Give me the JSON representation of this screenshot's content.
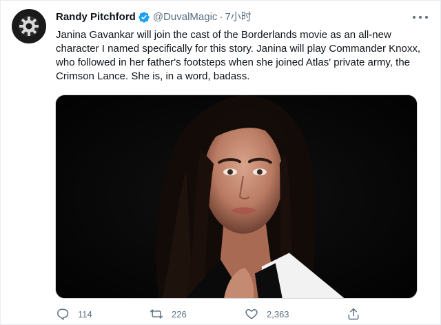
{
  "tweet": {
    "author": {
      "display_name": "Randy Pitchford",
      "handle": "@DuvalMagic",
      "verified": true,
      "avatar_icon": "gear-logo-icon"
    },
    "separator": "·",
    "time": "7小时",
    "text": "Janina Gavankar will join the cast of the Borderlands movie as an all-new character I named specifically for this story. Janina will play Commander Knoxx, who followed in her father's footsteps when she joined Atlas' private army, the Crimson Lance. She is, in a word, badass.",
    "media": {
      "kind": "photo"
    },
    "actions": {
      "reply": {
        "icon": "reply-icon",
        "count": "114"
      },
      "retweet": {
        "icon": "retweet-icon",
        "count": "226"
      },
      "like": {
        "icon": "heart-icon",
        "count": "2,363"
      },
      "share": {
        "icon": "share-icon",
        "count": ""
      }
    }
  },
  "colors": {
    "text_primary": "#0f1419",
    "text_secondary": "#5b7083",
    "verified_blue": "#1da1f2",
    "border": "#e6ecf0"
  }
}
